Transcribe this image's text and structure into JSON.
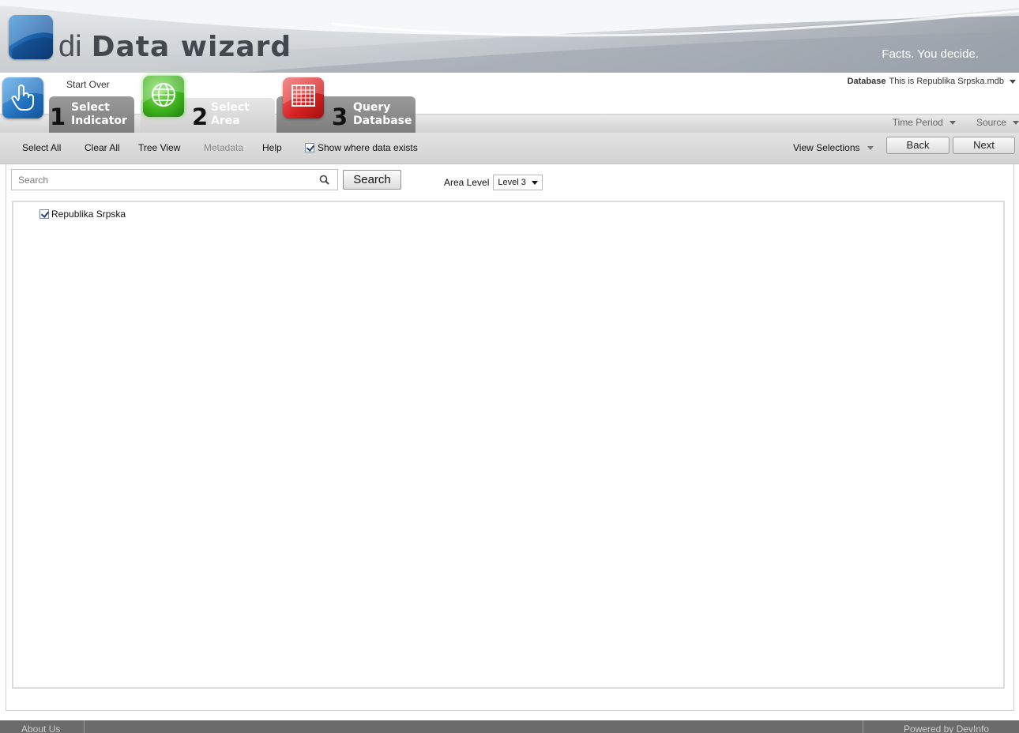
{
  "header": {
    "brand_prefix": "di",
    "brand_name": "Data wizard",
    "tagline": "Facts. You decide.",
    "database_label": "Database",
    "database_value": "This is Republika Srpska.mdb"
  },
  "steps": {
    "start_over": "Start Over",
    "items": [
      {
        "number": "1",
        "line1": "Select",
        "line2": "Indicator",
        "icon": "hand-pointer-icon",
        "active": false
      },
      {
        "number": "2",
        "line1": "Select",
        "line2": "Area",
        "icon": "globe-icon",
        "active": true
      },
      {
        "number": "3",
        "line1": "Query",
        "line2": "Database",
        "icon": "grid-table-icon",
        "active": false
      }
    ]
  },
  "filters": {
    "time_period": "Time Period",
    "source": "Source"
  },
  "toolbar": {
    "select_all": "Select All",
    "clear_all": "Clear All",
    "tree_view": "Tree View",
    "metadata": "Metadata",
    "help": "Help",
    "show_data_label": "Show where data exists",
    "show_data_checked": true,
    "view_selections": "View Selections",
    "back": "Back",
    "next": "Next"
  },
  "search": {
    "placeholder": "Search",
    "button": "Search",
    "area_level_label": "Area Level",
    "area_level_value": "Level 3"
  },
  "tree": {
    "items": [
      {
        "label": "Republika Srpska",
        "checked": true
      }
    ]
  },
  "footer": {
    "about": "About Us",
    "powered": "Powered by DevInfo"
  },
  "colors": {
    "step1_icon": "#1f6fbd",
    "step2_icon": "#3fb31e",
    "step3_icon": "#d42121",
    "footer_bg": "#6b6b6b"
  }
}
